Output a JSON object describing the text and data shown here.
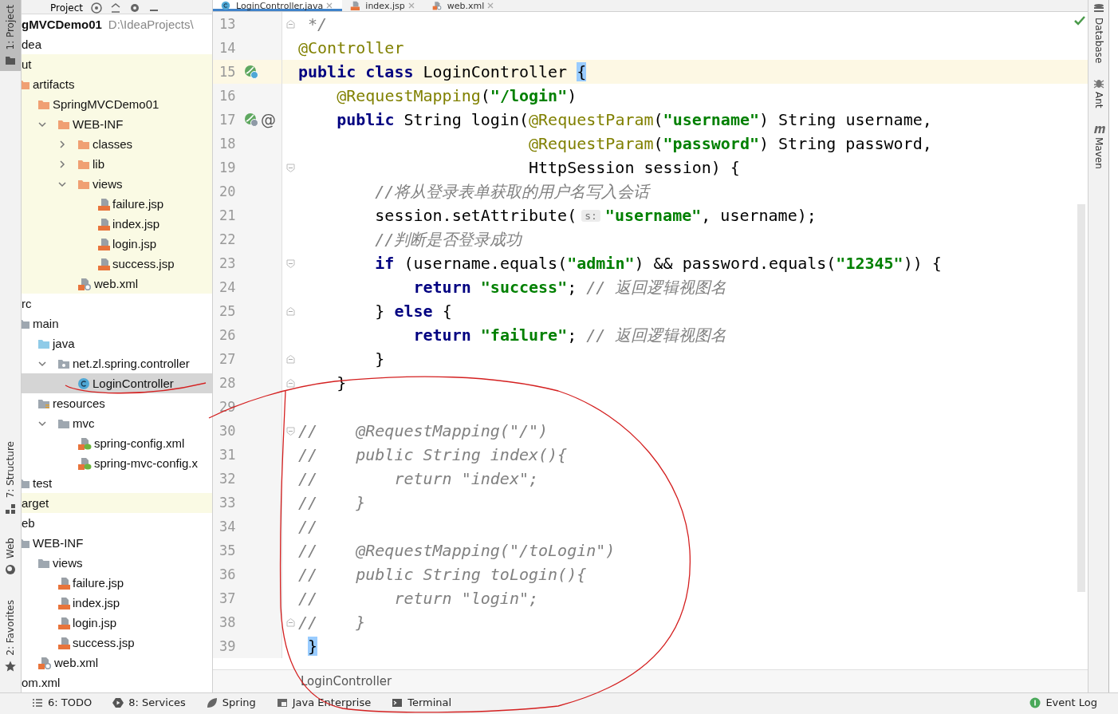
{
  "left_toolbar": [
    {
      "label": "1: Project",
      "kind": "folder",
      "selected": true
    },
    {
      "label": "7: Structure",
      "kind": "structure",
      "selected": false
    },
    {
      "label": "Web",
      "kind": "globe",
      "selected": false
    },
    {
      "label": "2: Favorites",
      "kind": "star",
      "selected": false
    }
  ],
  "project_panel": {
    "title": "Project",
    "tree": [
      {
        "label": "gMVCDemo01",
        "path": "D:\\IdeaProjects\\",
        "selected": false,
        "excluded": false,
        "children": [
          {
            "label": "dea",
            "selected": false,
            "excluded": false
          },
          {
            "label": "ut",
            "selected": false,
            "excluded": true,
            "children": [
              {
                "label": "artifacts",
                "kind": "folder-orange",
                "selected": false,
                "excluded": true,
                "children": [
                  {
                    "label": "SpringMVCDemo01",
                    "kind": "folder-orange",
                    "selected": false,
                    "excluded": true,
                    "children": [
                      {
                        "label": "WEB-INF",
                        "kind": "folder-orange",
                        "expanded": true,
                        "selected": false,
                        "excluded": true,
                        "children": [
                          {
                            "label": "classes",
                            "kind": "folder-orange",
                            "expanded": false,
                            "selected": false,
                            "excluded": true
                          },
                          {
                            "label": "lib",
                            "kind": "folder-orange",
                            "expanded": false,
                            "selected": false,
                            "excluded": true
                          },
                          {
                            "label": "views",
                            "kind": "folder-orange",
                            "expanded": true,
                            "selected": false,
                            "excluded": true,
                            "children": [
                              {
                                "label": "failure.jsp",
                                "kind": "jsp",
                                "selected": false,
                                "excluded": true
                              },
                              {
                                "label": "index.jsp",
                                "kind": "jsp",
                                "selected": false,
                                "excluded": true
                              },
                              {
                                "label": "login.jsp",
                                "kind": "jsp",
                                "selected": false,
                                "excluded": true
                              },
                              {
                                "label": "success.jsp",
                                "kind": "jsp",
                                "selected": false,
                                "excluded": true
                              }
                            ]
                          },
                          {
                            "label": "web.xml",
                            "kind": "web-xml",
                            "selected": false,
                            "excluded": true
                          }
                        ]
                      }
                    ]
                  }
                ]
              }
            ]
          },
          {
            "label": "rc",
            "selected": false,
            "excluded": false,
            "children": [
              {
                "label": "main",
                "kind": "folder-gray",
                "selected": false,
                "excluded": false,
                "children": [
                  {
                    "label": "java",
                    "kind": "folder-blue",
                    "selected": false,
                    "excluded": false,
                    "children": [
                      {
                        "label": "net.zl.spring.controller",
                        "kind": "package",
                        "expanded": true,
                        "selected": false,
                        "excluded": false,
                        "children": [
                          {
                            "label": "LoginController",
                            "kind": "class",
                            "selected": true,
                            "excluded": false
                          }
                        ]
                      }
                    ]
                  },
                  {
                    "label": "resources",
                    "kind": "resources",
                    "selected": false,
                    "excluded": false,
                    "children": [
                      {
                        "label": "mvc",
                        "kind": "folder-gray",
                        "expanded": true,
                        "selected": false,
                        "excluded": false,
                        "children": [
                          {
                            "label": "spring-config.xml",
                            "kind": "spring-xml",
                            "selected": false,
                            "excluded": false
                          },
                          {
                            "label": "spring-mvc-config.x",
                            "kind": "spring-xml",
                            "selected": false,
                            "excluded": false
                          }
                        ]
                      }
                    ]
                  }
                ]
              },
              {
                "label": "test",
                "kind": "folder-gray",
                "selected": false,
                "excluded": false
              }
            ]
          },
          {
            "label": "arget",
            "selected": false,
            "excluded": true
          },
          {
            "label": "eb",
            "selected": false,
            "excluded": false,
            "children": [
              {
                "label": "WEB-INF",
                "kind": "folder-gray",
                "selected": false,
                "excluded": false,
                "children": [
                  {
                    "label": "views",
                    "kind": "folder-gray",
                    "selected": false,
                    "excluded": false,
                    "children": [
                      {
                        "label": "failure.jsp",
                        "kind": "jsp",
                        "selected": false,
                        "excluded": false
                      },
                      {
                        "label": "index.jsp",
                        "kind": "jsp",
                        "selected": false,
                        "excluded": false
                      },
                      {
                        "label": "login.jsp",
                        "kind": "jsp",
                        "selected": false,
                        "excluded": false
                      },
                      {
                        "label": "success.jsp",
                        "kind": "jsp",
                        "selected": false,
                        "excluded": false
                      }
                    ]
                  },
                  {
                    "label": "web.xml",
                    "kind": "web-xml",
                    "selected": false,
                    "excluded": false
                  }
                ]
              }
            ]
          },
          {
            "label": "om.xml",
            "selected": false,
            "excluded": false
          }
        ]
      }
    ]
  },
  "editor": {
    "tabs": [
      {
        "label": "LoginController.java",
        "kind": "class",
        "selected": true
      },
      {
        "label": "index.jsp",
        "kind": "jsp",
        "selected": false
      },
      {
        "label": "web.xml",
        "kind": "web-xml",
        "selected": false
      }
    ],
    "lines": [
      {
        "number": "13",
        "caret": false,
        "gutter": [
          {
            "kind": "fold-end"
          }
        ],
        "tokens": [
          {
            "kind": "comment-doc",
            "text": " */"
          }
        ]
      },
      {
        "number": "14",
        "caret": false,
        "tokens": [
          {
            "kind": "annotation",
            "text": "@Controller"
          }
        ]
      },
      {
        "number": "15",
        "caret": true,
        "gutter": [
          {
            "kind": "bean-class"
          }
        ],
        "tokens": [
          {
            "kind": "keyword",
            "text": "public class"
          },
          {
            "kind": "plain",
            "text": " LoginController"
          },
          {
            "kind": "brace-match",
            "text": " {"
          }
        ]
      },
      {
        "number": "16",
        "caret": false,
        "tokens": [
          {
            "kind": "annotation",
            "text": "    @RequestMapping"
          },
          {
            "kind": "plain",
            "text": "("
          },
          {
            "kind": "string",
            "text": "\"/login\""
          },
          {
            "kind": "plain",
            "text": ")"
          }
        ]
      },
      {
        "number": "17",
        "caret": false,
        "gutter": [
          {
            "kind": "bean-method"
          },
          {
            "kind": "mark",
            "text": "@"
          }
        ],
        "tokens": [
          {
            "kind": "keyword",
            "text": "    public"
          },
          {
            "kind": "plain",
            "text": " String login("
          },
          {
            "kind": "annotation",
            "text": "@RequestParam"
          },
          {
            "kind": "plain",
            "text": "("
          },
          {
            "kind": "string",
            "text": "\"username\""
          },
          {
            "kind": "plain",
            "text": ") String username,"
          }
        ]
      },
      {
        "number": "18",
        "caret": false,
        "tokens": [
          {
            "kind": "annotation",
            "text": "                        @RequestParam"
          },
          {
            "kind": "plain",
            "text": "("
          },
          {
            "kind": "string",
            "text": "\"password\""
          },
          {
            "kind": "plain",
            "text": ") String password,"
          }
        ]
      },
      {
        "number": "19",
        "caret": false,
        "gutter": [
          {
            "kind": "fold-start"
          }
        ],
        "tokens": [
          {
            "kind": "plain",
            "text": "                        HttpSession session) {"
          }
        ]
      },
      {
        "number": "20",
        "caret": false,
        "tokens": [
          {
            "kind": "comment",
            "text": "        //将从登录表单获取的用户名写入会话"
          }
        ]
      },
      {
        "number": "21",
        "caret": false,
        "tokens": [
          {
            "kind": "plain",
            "text": "        session.setAttribute("
          },
          {
            "kind": "hint",
            "text": "s:"
          },
          {
            "kind": "string",
            "text": "\"username\""
          },
          {
            "kind": "plain",
            "text": ", username);"
          }
        ]
      },
      {
        "number": "22",
        "caret": false,
        "tokens": [
          {
            "kind": "comment",
            "text": "        //判断是否登录成功"
          }
        ]
      },
      {
        "number": "23",
        "caret": false,
        "gutter": [
          {
            "kind": "fold-start"
          }
        ],
        "tokens": [
          {
            "kind": "keyword",
            "text": "        if"
          },
          {
            "kind": "plain",
            "text": " (username.equals("
          },
          {
            "kind": "string",
            "text": "\"admin\""
          },
          {
            "kind": "plain",
            "text": ") && password.equals("
          },
          {
            "kind": "string",
            "text": "\"12345\""
          },
          {
            "kind": "plain",
            "text": ")) {"
          }
        ]
      },
      {
        "number": "24",
        "caret": false,
        "tokens": [
          {
            "kind": "keyword",
            "text": "            return"
          },
          {
            "kind": "string",
            "text": " \"success\""
          },
          {
            "kind": "plain",
            "text": ";"
          },
          {
            "kind": "comment",
            "text": " // 返回逻辑视图名"
          }
        ]
      },
      {
        "number": "25",
        "caret": false,
        "gutter": [
          {
            "kind": "fold-end"
          }
        ],
        "tokens": [
          {
            "kind": "plain",
            "text": "        }"
          },
          {
            "kind": "keyword",
            "text": " else"
          },
          {
            "kind": "plain",
            "text": " {"
          }
        ]
      },
      {
        "number": "26",
        "caret": false,
        "tokens": [
          {
            "kind": "keyword",
            "text": "            return"
          },
          {
            "kind": "string",
            "text": " \"failure\""
          },
          {
            "kind": "plain",
            "text": ";"
          },
          {
            "kind": "comment",
            "text": " // 返回逻辑视图名"
          }
        ]
      },
      {
        "number": "27",
        "caret": false,
        "gutter": [
          {
            "kind": "fold-end"
          }
        ],
        "tokens": [
          {
            "kind": "plain",
            "text": "        }"
          }
        ]
      },
      {
        "number": "28",
        "caret": false,
        "gutter": [
          {
            "kind": "fold-end"
          }
        ],
        "tokens": [
          {
            "kind": "plain",
            "text": "    }"
          }
        ]
      },
      {
        "number": "29",
        "caret": false
      },
      {
        "number": "30",
        "caret": false,
        "gutter": [
          {
            "kind": "fold-start"
          }
        ],
        "tokens": [
          {
            "kind": "comment-code",
            "text": "//    @RequestMapping(\"/\")"
          }
        ]
      },
      {
        "number": "31",
        "caret": false,
        "tokens": [
          {
            "kind": "comment-code",
            "text": "//    public String index(){"
          }
        ]
      },
      {
        "number": "32",
        "caret": false,
        "tokens": [
          {
            "kind": "comment-code",
            "text": "//        return \"index\";"
          }
        ]
      },
      {
        "number": "33",
        "caret": false,
        "tokens": [
          {
            "kind": "comment-code",
            "text": "//    }"
          }
        ]
      },
      {
        "number": "34",
        "caret": false,
        "tokens": [
          {
            "kind": "comment-code",
            "text": "//"
          }
        ]
      },
      {
        "number": "35",
        "caret": false,
        "tokens": [
          {
            "kind": "comment-code",
            "text": "//    @RequestMapping(\"/toLogin\")"
          }
        ]
      },
      {
        "number": "36",
        "caret": false,
        "tokens": [
          {
            "kind": "comment-code",
            "text": "//    public String toLogin(){"
          }
        ]
      },
      {
        "number": "37",
        "caret": false,
        "tokens": [
          {
            "kind": "comment-code",
            "text": "//        return \"login\";"
          }
        ]
      },
      {
        "number": "38",
        "caret": false,
        "gutter": [
          {
            "kind": "fold-end"
          }
        ],
        "tokens": [
          {
            "kind": "comment-code",
            "text": "//    }"
          }
        ]
      },
      {
        "number": "39",
        "caret": false,
        "tokens": [
          {
            "kind": "brace-match",
            "text": " }"
          }
        ]
      }
    ],
    "breadcrumb": "LoginController"
  },
  "right_toolbar": [
    {
      "label": "Database",
      "kind": "database"
    },
    {
      "label": "Ant",
      "kind": "ant"
    },
    {
      "label": "Maven",
      "kind": "maven"
    }
  ],
  "status_bar": {
    "left": [
      {
        "label": "6: TODO",
        "kind": "list"
      },
      {
        "label": "8: Services",
        "kind": "services"
      },
      {
        "label": "Spring",
        "kind": "leaf"
      },
      {
        "label": "Java Enterprise",
        "kind": "enterprise"
      },
      {
        "label": "Terminal",
        "kind": "terminal"
      }
    ],
    "right": [
      {
        "label": "Event Log",
        "kind": "event"
      }
    ]
  }
}
